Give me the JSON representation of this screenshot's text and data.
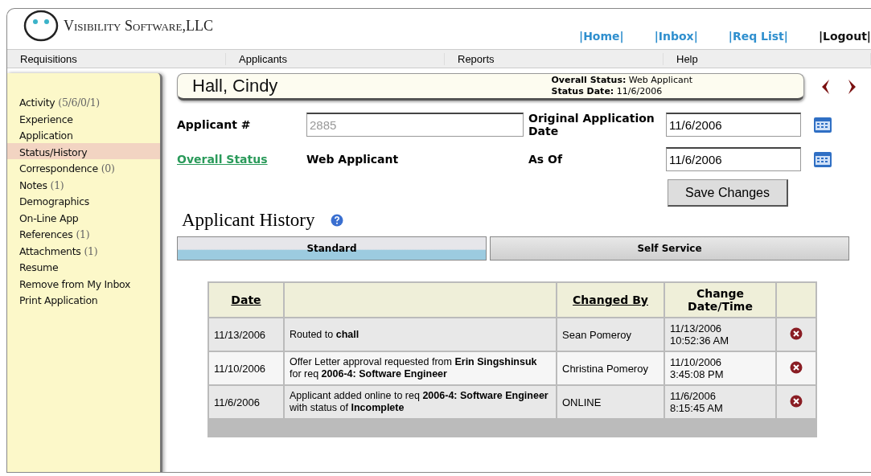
{
  "header": {
    "logo_text": "Visibility Software,LLC",
    "links": [
      {
        "label": "|Home|",
        "kind": "link"
      },
      {
        "label": "|Inbox|",
        "kind": "link"
      },
      {
        "label": "|Req List|",
        "kind": "link"
      },
      {
        "label": "|Logout|",
        "kind": "plain"
      }
    ]
  },
  "menu": [
    "Requisitions",
    "Applicants",
    "Reports",
    "Help"
  ],
  "sidebar": {
    "items": [
      {
        "label": "Activity",
        "count": "(5/6/0/1)",
        "selected": false
      },
      {
        "label": "Experience",
        "selected": false
      },
      {
        "label": "Application",
        "selected": false
      },
      {
        "label": "Status/History",
        "selected": true
      },
      {
        "label": "Correspondence",
        "count": "(0)",
        "selected": false
      },
      {
        "label": "Notes",
        "count": "(1)",
        "selected": false
      },
      {
        "label": "Demographics",
        "selected": false
      },
      {
        "label": "On-Line App",
        "selected": false
      },
      {
        "label": "References",
        "count": "(1)",
        "selected": false
      },
      {
        "label": "Attachments",
        "count": "(1)",
        "selected": false
      },
      {
        "label": "Resume",
        "selected": false
      },
      {
        "label": "Remove from My Inbox",
        "selected": false
      },
      {
        "label": "Print Application",
        "selected": false
      }
    ]
  },
  "applicant": {
    "name": "Hall, Cindy",
    "status_line": "**Overall Status:** Web Applicant",
    "date_line": "**Status Date:** 11/6/2006"
  },
  "form": {
    "applicant_label": "Applicant #",
    "applicant_value": "2885",
    "original_label": "Original Application Date",
    "original_value": "11/6/2006",
    "status_link": "Overall Status",
    "status_value": "Web Applicant",
    "as_of_label": "As Of",
    "as_of_value": "11/6/2006",
    "save_button": "Save Changes"
  },
  "history": {
    "title": "Applicant History",
    "tabs": [
      {
        "label": "Standard",
        "selected": true
      },
      {
        "label": "Self Service",
        "selected": false
      }
    ],
    "columns": [
      "Date",
      "",
      "Changed By",
      "Change Date/Time",
      ""
    ],
    "rows": [
      {
        "date": "11/13/2006",
        "description": "Routed to **chall**",
        "changed_by": "Sean Pomeroy",
        "change_date": "11/13/2006",
        "change_time": "10:52:36 AM"
      },
      {
        "date": "11/10/2006",
        "description": "Offer Letter approval requested from **Erin Singshinsuk** for req **2006-4: Software Engineer**",
        "changed_by": "Christina Pomeroy",
        "change_date": "11/10/2006",
        "change_time": "3:45:08 PM"
      },
      {
        "date": "11/6/2006",
        "description": "Applicant added online to req **2006-4: Software Engineer** with status of **Incomplete**",
        "changed_by": "ONLINE",
        "change_date": "11/6/2006",
        "change_time": "8:15:45 AM"
      }
    ]
  }
}
